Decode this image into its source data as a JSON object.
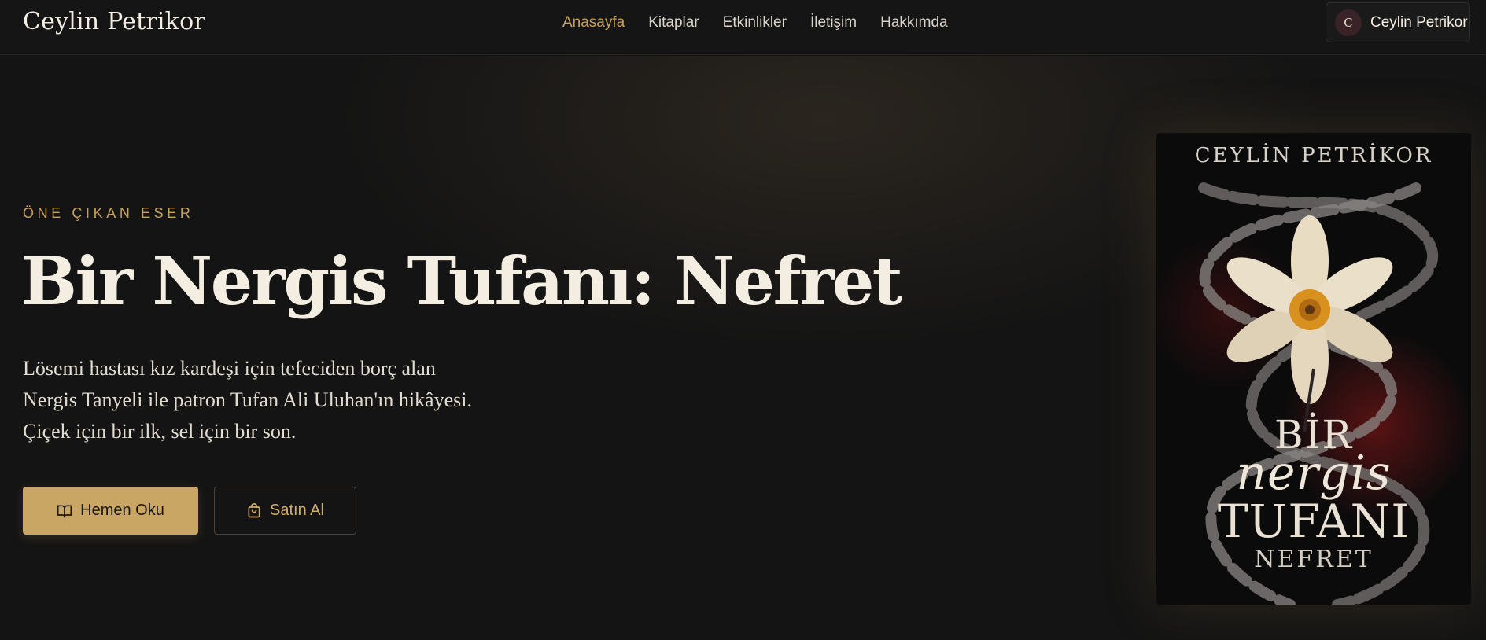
{
  "header": {
    "brand": "Ceylin Petrikor",
    "nav": [
      {
        "label": "Anasayfa",
        "active": true
      },
      {
        "label": "Kitaplar",
        "active": false
      },
      {
        "label": "Etkinlikler",
        "active": false
      },
      {
        "label": "İletişim",
        "active": false
      },
      {
        "label": "Hakkımda",
        "active": false
      }
    ],
    "user": {
      "initial": "C",
      "name": "Ceylin Petrikor"
    }
  },
  "hero": {
    "eyebrow": "ÖNE ÇIKAN ESER",
    "title": "Bir Nergis Tufanı: Nefret",
    "description_lines": [
      "Lösemi hastası kız kardeşi için tefeciden borç alan",
      "Nergis Tanyeli ile patron Tufan Ali Uluhan'ın hikâyesi.",
      "Çiçek için bir ilk, sel için bir son."
    ],
    "primary_button": {
      "label": "Hemen Oku",
      "icon": "book-open-icon"
    },
    "secondary_button": {
      "label": "Satın Al",
      "icon": "shopping-bag-icon"
    }
  },
  "cover": {
    "author": "CEYLİN PETRİKOR",
    "title_line1": "BİR",
    "title_line2": "nergis",
    "title_line3": "TUFANI",
    "subtitle": "NEFRET"
  },
  "colors": {
    "accent": "#c9a15c",
    "button_gold": "#c9a663",
    "background": "#141414",
    "text": "#f3ede2"
  }
}
